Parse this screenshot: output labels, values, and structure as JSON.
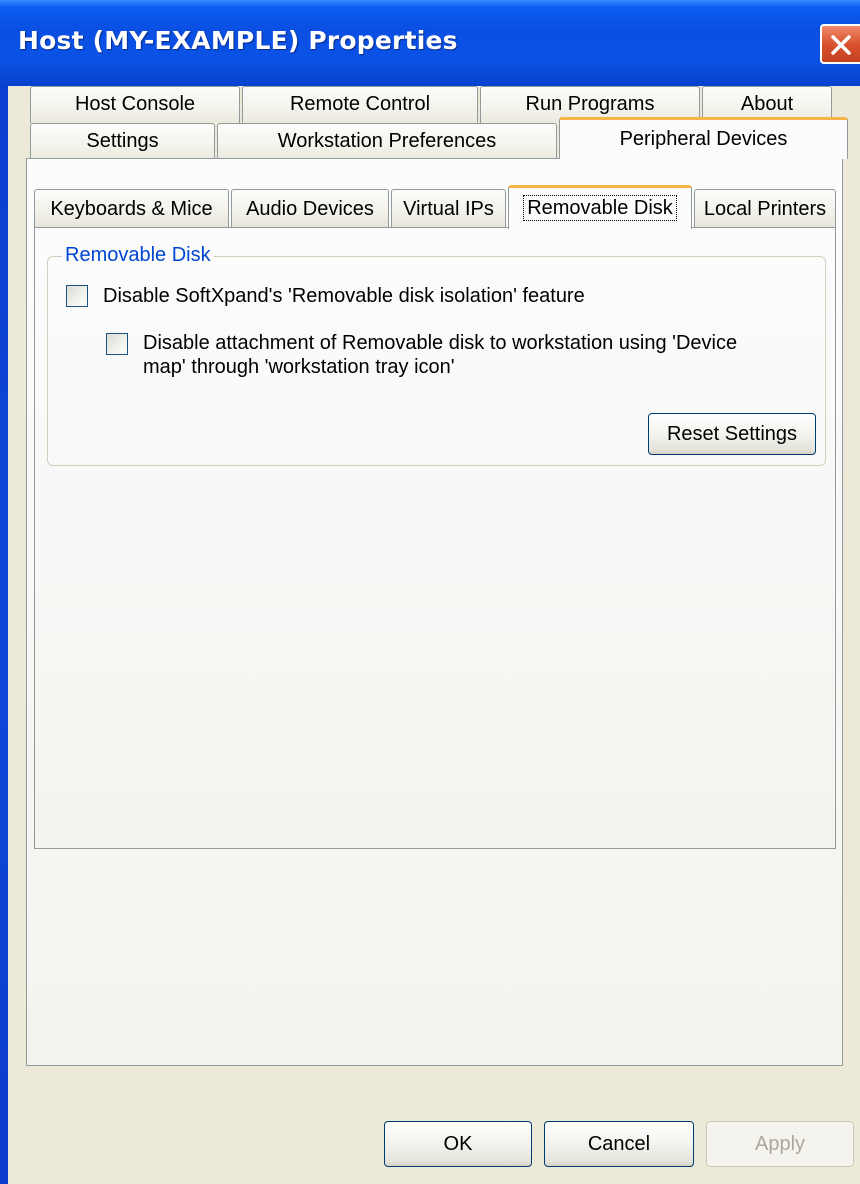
{
  "window": {
    "title": "Host (MY-EXAMPLE) Properties"
  },
  "top_tabs": {
    "row1": [
      "Host Console",
      "Remote Control",
      "Run Programs",
      "About"
    ],
    "row2": [
      "Settings",
      "Workstation Preferences",
      "Peripheral Devices"
    ],
    "active": "Peripheral Devices"
  },
  "inner_tabs": {
    "items": [
      "Keyboards & Mice",
      "Audio Devices",
      "Virtual IPs",
      "Removable Disk",
      "Local Printers"
    ],
    "active": "Removable Disk"
  },
  "removable_disk": {
    "group_title": "Removable Disk",
    "option1": {
      "label": "Disable SoftXpand's 'Removable disk isolation' feature",
      "checked": false
    },
    "option2": {
      "label_line1": "Disable attachment of Removable disk to workstation using 'Device",
      "label_line2": "map' through 'workstation tray icon'",
      "checked": false
    },
    "reset_button": "Reset Settings"
  },
  "buttons": {
    "ok": "OK",
    "cancel": "Cancel",
    "apply": "Apply",
    "apply_enabled": false
  },
  "colors": {
    "title_bar": "#0a52e6",
    "close_button": "#d9532f",
    "dialog_face": "#ece9d8",
    "active_tab_accent": "#f3b547",
    "group_label": "#0046d5"
  }
}
